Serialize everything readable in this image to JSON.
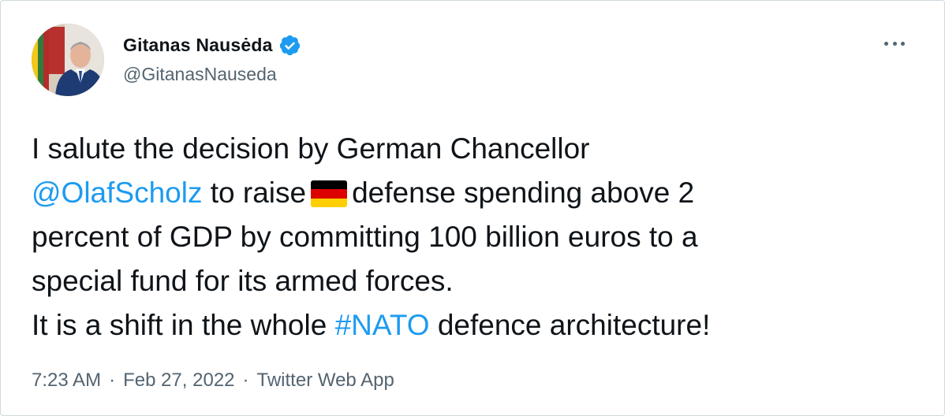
{
  "author": {
    "display_name": "Gitanas Nausėda",
    "handle": "@GitanasNauseda",
    "verified_icon": "verified-badge-icon",
    "avatar_icon": "profile-avatar"
  },
  "menu": {
    "icon": "more-options-icon"
  },
  "tweet": {
    "line1": "I salute the decision by German Chancellor",
    "mention": "@OlafScholz",
    "line2_a": " to raise",
    "flag_icon": "germany-flag-emoji",
    "line2_b": "defense spending above 2",
    "line3": "percent of GDP by committing 100 billion euros to a",
    "line4": "special fund for its armed forces.",
    "line5_a": "It is a shift in the whole ",
    "hashtag": "#NATO",
    "line5_b": " defence architecture!"
  },
  "meta": {
    "time": "7:23 AM",
    "sep1": "·",
    "date": "Feb 27, 2022",
    "sep2": "·",
    "source": "Twitter Web App"
  },
  "colors": {
    "link": "#1d9bf0",
    "secondary_text": "#536471",
    "primary_text": "#0f1419",
    "border": "#cfd9de"
  }
}
